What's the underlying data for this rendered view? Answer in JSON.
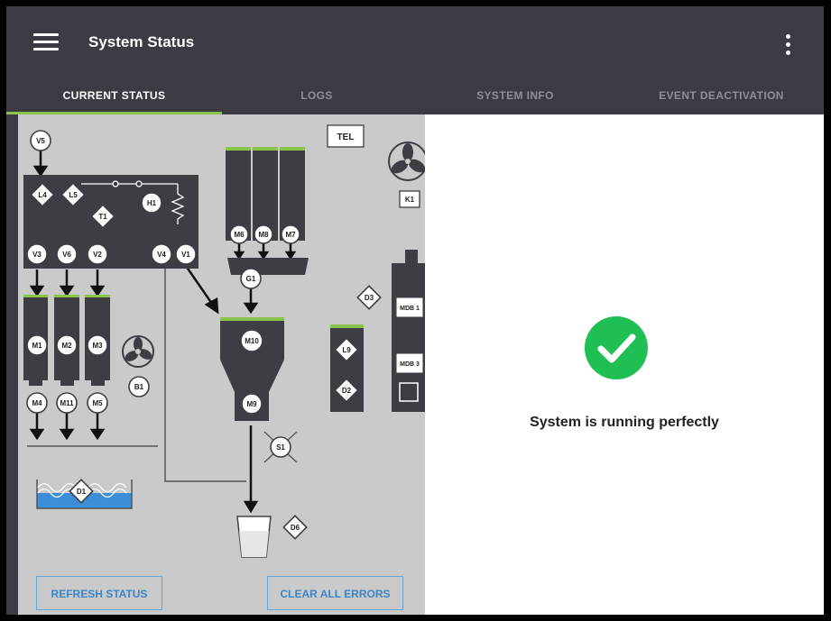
{
  "header": {
    "title": "System Status",
    "menu_icon": "hamburger-menu-icon",
    "more_icon": "more-vertical-icon"
  },
  "tabs": [
    {
      "label": "CURRENT STATUS",
      "active": true
    },
    {
      "label": "LOGS",
      "active": false
    },
    {
      "label": "SYSTEM INFO",
      "active": false
    },
    {
      "label": "EVENT DEACTIVATION",
      "active": false
    }
  ],
  "diagram": {
    "labels": {
      "V5": "V5",
      "L4": "L4",
      "L5": "L5",
      "H1": "H1",
      "T1": "T1",
      "V3": "V3",
      "V6": "V6",
      "V2": "V2",
      "V4": "V4",
      "V1": "V1",
      "M1": "M1",
      "M2": "M2",
      "M3": "M3",
      "M4": "M4",
      "M11": "M11",
      "M5": "M5",
      "B1": "B1",
      "D1": "D1",
      "TEL": "TEL",
      "K1": "K1",
      "M6": "M6",
      "M8": "M8",
      "M7": "M7",
      "G1": "G1",
      "M10": "M10",
      "M9": "M9",
      "S1": "S1",
      "D6": "D6",
      "D3": "D3",
      "L9": "L9",
      "D2": "D2",
      "MDB1": "MDB 1",
      "MDB3": "MDB 3"
    },
    "icons": [
      "fan-icon",
      "valve-icon",
      "heater-icon",
      "cup-icon",
      "water-tank-icon"
    ],
    "colors": {
      "fill": "#3e3d44",
      "level": "#8bc34a",
      "water": "#3a8fd8",
      "background": "#cacaca"
    }
  },
  "actions": {
    "refresh": "REFRESH STATUS",
    "clear": "CLEAR ALL ERRORS"
  },
  "status": {
    "message": "System is running perfectly",
    "icon": "check-circle-icon",
    "color": "#1fbf54"
  },
  "theme": {
    "appbar": "#3c3b44",
    "accent": "#8bc34a",
    "button": "#3d85c6"
  }
}
